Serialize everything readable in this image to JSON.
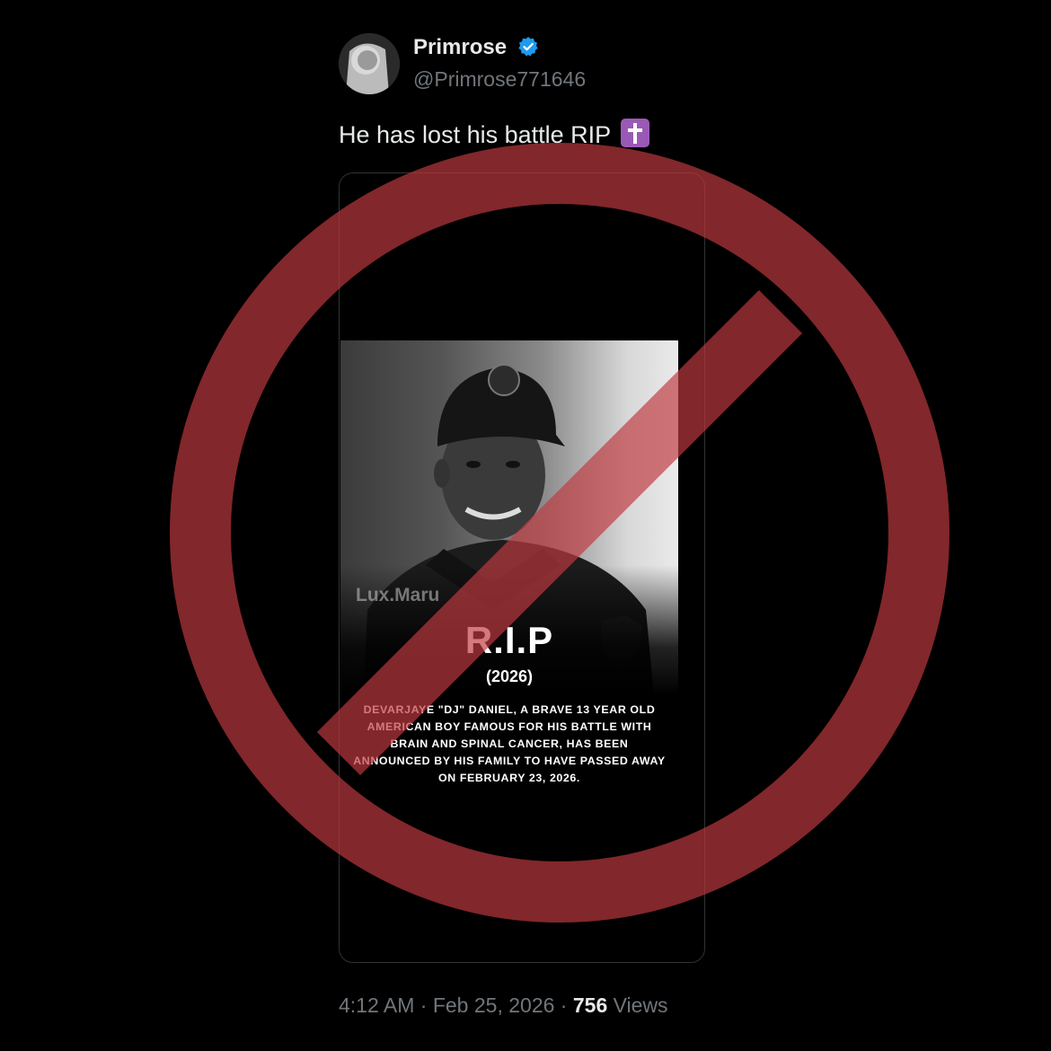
{
  "tweet": {
    "display_name": "Primrose",
    "handle": "@Primrose771646",
    "text": "He has lost his battle RIP",
    "emoji_icon": "latin-cross-emoji",
    "verified_icon": "verified-badge-icon"
  },
  "media": {
    "watermark": "Lux.Maru",
    "rip_title": "R.I.P",
    "rip_year": "(2026)",
    "rip_body": "DEVARJAYE \"DJ\" DANIEL, A BRAVE 13 YEAR OLD AMERICAN BOY FAMOUS FOR HIS BATTLE WITH BRAIN AND SPINAL CANCER, HAS BEEN ANNOUNCED BY HIS FAMILY TO HAVE PASSED AWAY ON FEBRUARY 23, 2026."
  },
  "meta": {
    "time": "4:12 AM",
    "separator": "·",
    "date": "Feb 25, 2026",
    "views_count": "756",
    "views_label": "Views"
  },
  "overlay": {
    "icon": "prohibition-sign-icon",
    "color": "#8b2c2f"
  },
  "colors": {
    "background": "#000000",
    "primary_text": "#e7e9ea",
    "secondary_text": "#71767b",
    "verified": "#1d9bf0"
  }
}
